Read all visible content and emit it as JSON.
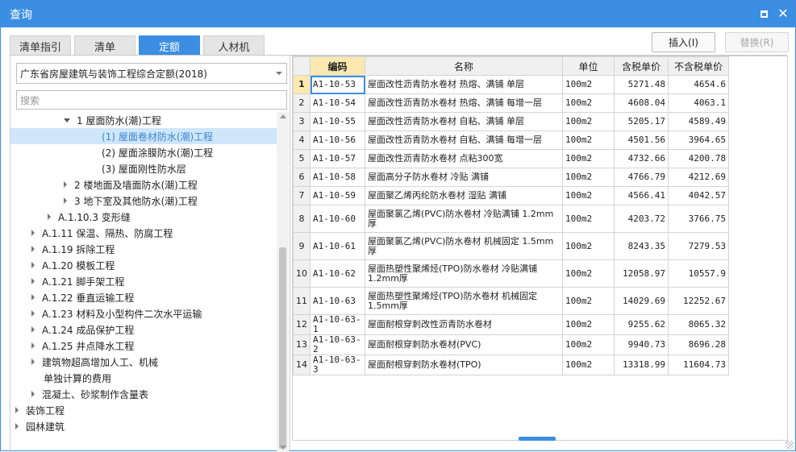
{
  "window": {
    "title": "查询",
    "accent": "#3c8ee2"
  },
  "tabs": [
    {
      "label": "清单指引",
      "active": false
    },
    {
      "label": "清单",
      "active": false
    },
    {
      "label": "定额",
      "active": true
    },
    {
      "label": "人材机",
      "active": false
    }
  ],
  "buttons": {
    "insert": "插入(I)",
    "replace": "替换(R)"
  },
  "left": {
    "quota_select": "广东省房屋建筑与装饰工程综合定额(2018)",
    "search_placeholder": "搜索",
    "tree": [
      {
        "label": "1 屋面防水(潮)工程",
        "expanded": true,
        "arrow": "down"
      },
      {
        "label": "(1) 屋面卷材防水(潮)工程",
        "selected": true,
        "arrow": "none"
      },
      {
        "label": "(2) 屋面涂膜防水(潮)工程",
        "arrow": "none"
      },
      {
        "label": "(3) 屋面刚性防水层",
        "arrow": "none"
      },
      {
        "label": "2 楼地面及墙面防水(潮)工程",
        "arrow": "right"
      },
      {
        "label": "3 地下室及其他防水(潮)工程",
        "arrow": "right"
      },
      {
        "label": "A.1.10.3 变形缝",
        "arrow": "right"
      },
      {
        "label": "A.1.11 保温、隔热、防腐工程",
        "arrow": "right"
      },
      {
        "label": "A.1.19 拆除工程",
        "arrow": "right"
      },
      {
        "label": "A.1.20 模板工程",
        "arrow": "right"
      },
      {
        "label": "A.1.21 脚手架工程",
        "arrow": "right"
      },
      {
        "label": "A.1.22 垂直运输工程",
        "arrow": "right"
      },
      {
        "label": "A.1.23 材料及小型构件二次水平运输",
        "arrow": "right"
      },
      {
        "label": "A.1.24 成品保护工程",
        "arrow": "right"
      },
      {
        "label": "A.1.25 井点降水工程",
        "arrow": "right"
      },
      {
        "label": "建筑物超高增加人工、机械",
        "arrow": "right"
      },
      {
        "label": "单独计算的费用",
        "arrow": "none"
      },
      {
        "label": "混凝土、砂浆制作含量表",
        "arrow": "right"
      },
      {
        "label": "装饰工程",
        "arrow": "right"
      },
      {
        "label": "园林建筑",
        "arrow": "right"
      }
    ]
  },
  "table": {
    "headers": [
      "编码",
      "名称",
      "单位",
      "含税单价",
      "不含税单价"
    ],
    "rows": [
      {
        "no": "1",
        "code": "A1-10-53",
        "name": "屋面改性沥青防水卷材 热熔、满铺 单层",
        "unit": "100m2",
        "tax_price": "5271.48",
        "notax_price": "4654.6"
      },
      {
        "no": "2",
        "code": "A1-10-54",
        "name": "屋面改性沥青防水卷材 热熔、满铺 每增一层",
        "unit": "100m2",
        "tax_price": "4608.04",
        "notax_price": "4063.1"
      },
      {
        "no": "3",
        "code": "A1-10-55",
        "name": "屋面改性沥青防水卷材 自粘、满铺 单层",
        "unit": "100m2",
        "tax_price": "5205.17",
        "notax_price": "4589.49"
      },
      {
        "no": "4",
        "code": "A1-10-56",
        "name": "屋面改性沥青防水卷材 自粘、满铺 每增一层",
        "unit": "100m2",
        "tax_price": "4501.56",
        "notax_price": "3964.65"
      },
      {
        "no": "5",
        "code": "A1-10-57",
        "name": "屋面改性沥青防水卷材 点粘300宽",
        "unit": "100m2",
        "tax_price": "4732.66",
        "notax_price": "4200.78"
      },
      {
        "no": "6",
        "code": "A1-10-58",
        "name": "屋面高分子防水卷材 冷贴 满铺",
        "unit": "100m2",
        "tax_price": "4766.79",
        "notax_price": "4212.69"
      },
      {
        "no": "7",
        "code": "A1-10-59",
        "name": "屋面聚乙烯丙纶防水卷材 湿贴 满铺",
        "unit": "100m2",
        "tax_price": "4566.41",
        "notax_price": "4042.57"
      },
      {
        "no": "8",
        "code": "A1-10-60",
        "name": "屋面聚氯乙烯(PVC)防水卷材 冷贴满铺 1.2mm厚",
        "unit": "100m2",
        "tax_price": "4203.72",
        "notax_price": "3766.75",
        "tall": true
      },
      {
        "no": "9",
        "code": "A1-10-61",
        "name": "屋面聚氯乙烯(PVC)防水卷材 机械固定 1.5mm厚",
        "unit": "100m2",
        "tax_price": "8243.35",
        "notax_price": "7279.53",
        "tall": true
      },
      {
        "no": "10",
        "code": "A1-10-62",
        "name": "屋面热塑性聚烯烃(TPO)防水卷材 冷贴满铺 1.2mm厚",
        "unit": "100m2",
        "tax_price": "12058.97",
        "notax_price": "10557.9",
        "tall": true
      },
      {
        "no": "11",
        "code": "A1-10-63",
        "name": "屋面热塑性聚烯烃(TPO)防水卷材 机械固定 1.5mm厚",
        "unit": "100m2",
        "tax_price": "14029.69",
        "notax_price": "12252.67",
        "tall": true
      },
      {
        "no": "12",
        "code": "A1-10-63-1",
        "name": "屋面耐根穿刺改性沥青防水卷材",
        "unit": "100m2",
        "tax_price": "9255.62",
        "notax_price": "8065.32"
      },
      {
        "no": "13",
        "code": "A1-10-63-2",
        "name": "屋面耐根穿刺防水卷材(PVC)",
        "unit": "100m2",
        "tax_price": "9940.73",
        "notax_price": "8696.28"
      },
      {
        "no": "14",
        "code": "A1-10-63-3",
        "name": "屋面耐根穿刺防水卷材(TPO)",
        "unit": "100m2",
        "tax_price": "13318.99",
        "notax_price": "11604.73"
      }
    ]
  }
}
